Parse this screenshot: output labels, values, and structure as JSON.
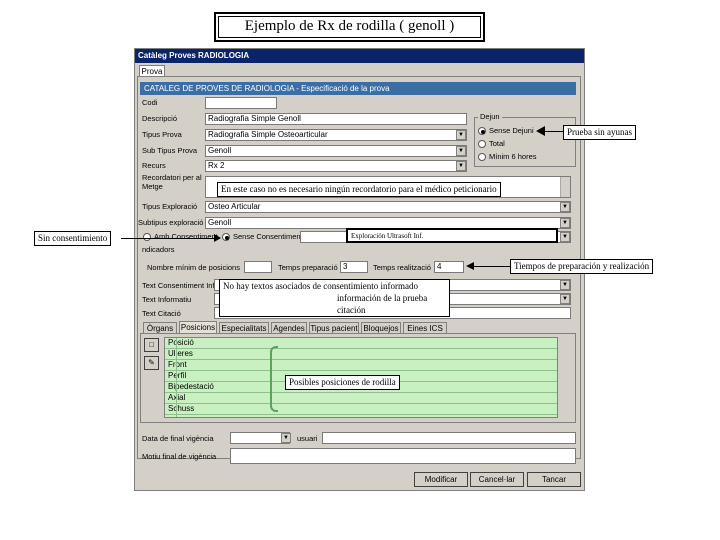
{
  "slide_title": "Ejemplo de Rx de rodilla ( genoll )",
  "window": {
    "title": "Catàleg Proves RADIOLOGIA",
    "tab_main": "Prova",
    "header": "CATALEG DE PROVES DE RADIOLOGIA - Especificació de la prova"
  },
  "form": {
    "codi_label": "Codi",
    "codi_value": "",
    "descripcio_label": "Descripció",
    "descripcio_value": "Radiografia Simple Genoll",
    "tipus_prova_label": "Tipus Prova",
    "tipus_prova_value": "Radiografia Simple Osteoarticular",
    "sub_tipus_label": "Sub Tipus Prova",
    "sub_tipus_value": "Genoll",
    "recurs_label": "Recurs",
    "recurs_value": "Rx 2",
    "recordatori_label": "Recordatori per al Metge",
    "tipus_exploracio_label": "Tipus Exploració",
    "tipus_exploracio_value": "Osteo Articular",
    "subtipus_exploracio_label": "Subtipus exploració",
    "subtipus_exploracio_value": "Genoll",
    "consent_with_label": "Amb Consentiment",
    "consent_without_label": "Sense Consentiment",
    "indicadors_label": "ndicadors",
    "num_posicions_label": "Nombre mínim de posicions",
    "num_posicions_value": "",
    "temps_preparacio_label": "Temps preparació",
    "temps_preparacio_value": "3",
    "temps_realitzacio_label": "Temps realització",
    "temps_realitzacio_value": "4",
    "text_consent_label": "Text Consentiment Inf",
    "text_informatiu_label": "Text Informatiu",
    "text_citacio_label": "Text Citació",
    "data_vigencia_label": "Data de final vigència",
    "data_vigencia_value": "",
    "usuari_label": "usuari",
    "motiu_label": "Motiu final de vigència"
  },
  "dejun": {
    "title": "Dejun",
    "options": [
      "Sense Dejuni",
      "Total",
      "Mínim 6 hores"
    ]
  },
  "subtabs": [
    "Òrgans",
    "Posicions",
    "Especialitats",
    "Agendes",
    "Tipus pacient",
    "Bloquejos",
    "Eines ICS"
  ],
  "positions": [
    "Posició",
    "Ulleres",
    "Front",
    "Perfil",
    "Bipedestació",
    "Axial",
    "Schuss"
  ],
  "buttons": {
    "modify": "Modificar",
    "cancel": "Cancel·lar",
    "close": "Tancar"
  },
  "callouts": {
    "prueba_ayunas": "Prueba sin ayunas",
    "recordatorio": "En este caso no es necesario ningún recordatorio para el médico peticionario",
    "sin_consentimiento": "Sin consentimiento",
    "exploracion": "Exploración Ultrasoft Inf.",
    "tiempos": "Tiempos de preparación y realización",
    "textos_line1": "No hay textos asociados de  consentimiento informado",
    "textos_line2": "información de la prueba",
    "textos_line3": "citación",
    "posiciones": "Posibles posiciones de rodilla"
  }
}
